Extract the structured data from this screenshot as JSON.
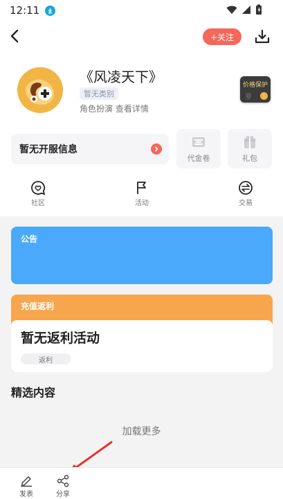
{
  "status_bar": {
    "time": "12:11"
  },
  "header": {
    "follow_label": "+关注"
  },
  "game": {
    "title": "《风凌天下》",
    "category": "暂无类别",
    "genre_detail": "角色扮演 查看详情",
    "price_protect_label": "价格保护"
  },
  "server": {
    "text": "暂无开服信息"
  },
  "cards": {
    "voucher_label": "代金卷",
    "gift_label": "礼包"
  },
  "nav": {
    "community": "社区",
    "activity": "活动",
    "trade": "交易"
  },
  "notice": {
    "title": "公告"
  },
  "rebate": {
    "title": "充值返利",
    "empty_text": "暂无返利活动",
    "tag": "返利"
  },
  "featured": {
    "title": "精选内容",
    "load_more": "加载更多"
  },
  "bottom_bar": {
    "post_label": "发表",
    "share_label": "分享"
  },
  "colors": {
    "accent_red": "#f5675b",
    "notice_blue": "#4aa9fb",
    "rebate_orange": "#f7a64e"
  },
  "icons": [
    "download-icon",
    "wifi-icon",
    "signal-icon",
    "battery-icon",
    "back-arrow-icon",
    "download-icon",
    "ticket-icon",
    "gift-icon",
    "heart-chat-icon",
    "flag-icon",
    "exchange-icon",
    "pen-icon",
    "share-icon"
  ]
}
